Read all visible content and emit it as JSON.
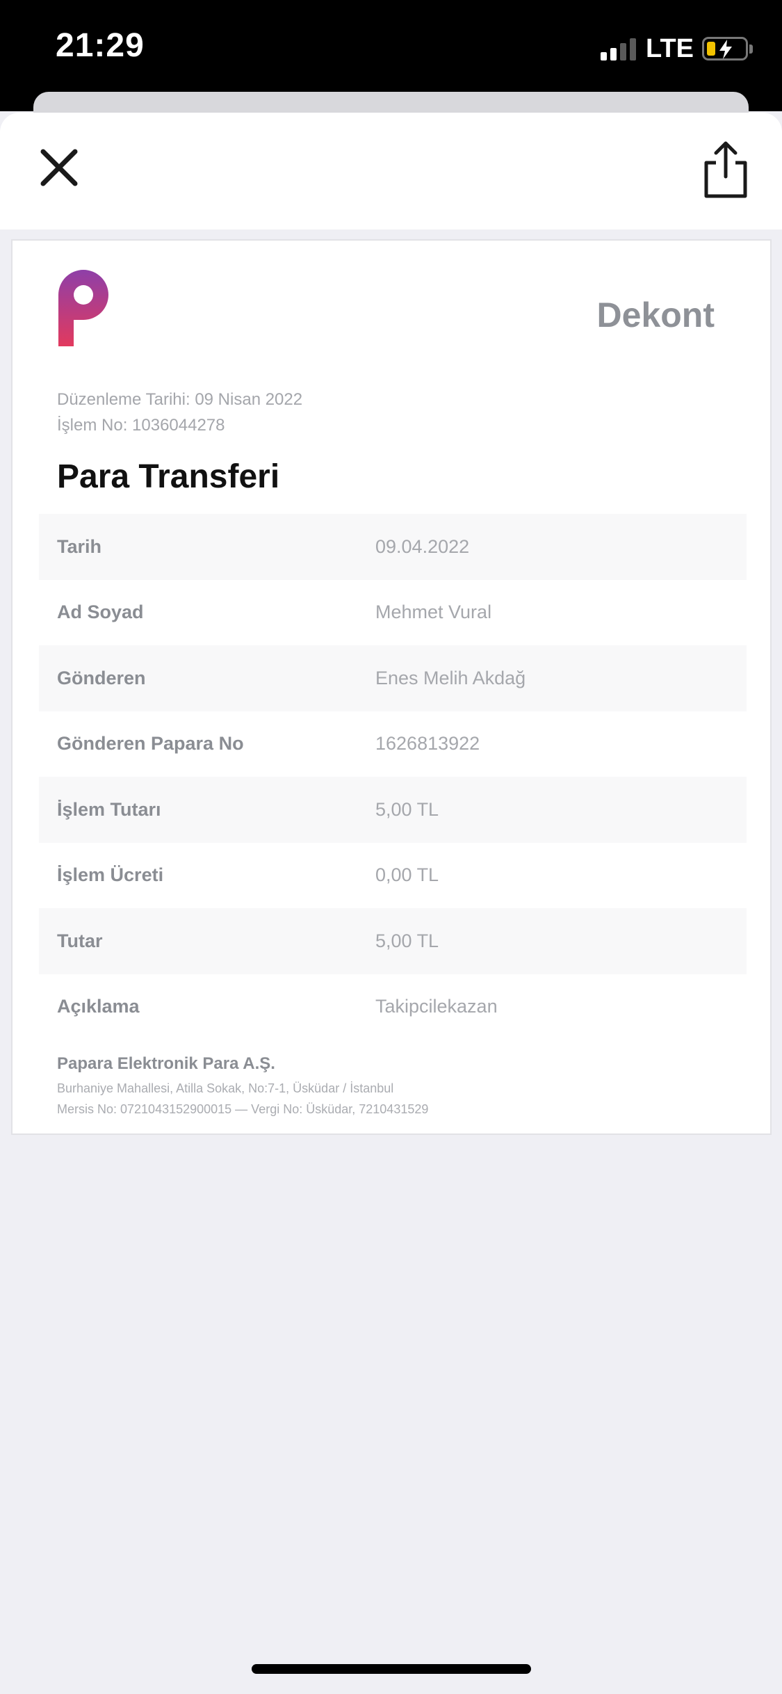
{
  "status_bar": {
    "time": "21:29",
    "network": "LTE",
    "signal_bars": 4,
    "signal_active_bars": 2,
    "battery_level": 0.2,
    "battery_charging": true
  },
  "header": {
    "close_icon": "close-icon",
    "share_icon": "share-icon"
  },
  "receipt": {
    "heading": "Dekont",
    "meta_date": "Düzenleme Tarihi: 09 Nisan 2022",
    "meta_number": "İşlem No: 1036044278",
    "title": "Para Transferi",
    "rows": [
      {
        "label": "Tarih",
        "value": "09.04.2022"
      },
      {
        "label": "Ad Soyad",
        "value": "Mehmet Vural"
      },
      {
        "label": "Gönderen",
        "value": "Enes Melih Akdağ"
      },
      {
        "label": "Gönderen Papara No",
        "value": "1626813922"
      },
      {
        "label": "İşlem Tutarı",
        "value": "5,00 TL"
      },
      {
        "label": "İşlem Ücreti",
        "value": "0,00 TL"
      },
      {
        "label": "Tutar",
        "value": "5,00 TL"
      },
      {
        "label": "Açıklama",
        "value": "Takipcilekazan"
      }
    ],
    "footer": {
      "company": "Papara Elektronik Para A.Ş.",
      "address": "Burhaniye Mahallesi, Atilla Sokak, No:7-1, Üsküdar / İstanbul",
      "registry": "Mersis No: 0721043152900015 — Vergi No: Üsküdar, 7210431529"
    }
  },
  "colors": {
    "logo_top": "#8e3fa8",
    "logo_bottom": "#e23a5e",
    "row_shade": "#f8f8f9",
    "background": "#efeff4"
  }
}
